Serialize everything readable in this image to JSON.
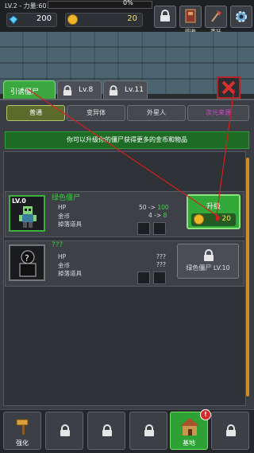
{
  "status": {
    "level_text": "LV.2 - 力量:60",
    "xp_percent_label": "0%",
    "xp_progress": 0,
    "gems": "200",
    "coins": "20"
  },
  "top_buttons": [
    {
      "name": "lock",
      "label": ""
    },
    {
      "name": "book-icon",
      "label": "图鉴"
    },
    {
      "name": "axe-icon",
      "label": "委托"
    },
    {
      "name": "gear-icon",
      "label": ""
    }
  ],
  "tabs": [
    {
      "label": "引诱僵尸",
      "active": true
    },
    {
      "label": "Lv.8",
      "locked": true
    },
    {
      "label": "Lv.11",
      "locked": true
    }
  ],
  "filters": [
    "普通",
    "变异体",
    "外星人",
    "次元来源"
  ],
  "banner": "你可以升级你的僵尸获得更多的金币和物品",
  "zombies": [
    {
      "level": "LV.0",
      "name": "绿色僵尸",
      "hp_label": "HP",
      "coin_label": "金币",
      "drop_label": "掉落道具",
      "hp_from": "50 ->",
      "hp_to": "100",
      "coin_from": "4 ->",
      "coin_to": "8",
      "button_label": "升级",
      "price": "20"
    },
    {
      "name": "???",
      "hp_label": "HP",
      "coin_label": "金币",
      "drop_label": "掉落道具",
      "hp_val": "???",
      "coin_val": "???",
      "drop_val": "???",
      "locked_label": "绿色僵尸 LV.10"
    }
  ],
  "bottom_nav": [
    {
      "label": "强化",
      "locked": false
    },
    {
      "label": "",
      "locked": true
    },
    {
      "label": "",
      "locked": true
    },
    {
      "label": "",
      "locked": true
    },
    {
      "label": "基地",
      "locked": false,
      "alert": "!"
    },
    {
      "label": "",
      "locked": true
    }
  ],
  "colors": {
    "accent_green": "#3aa83e",
    "coin": "#f0b62a",
    "alert": "#d52a2a"
  }
}
